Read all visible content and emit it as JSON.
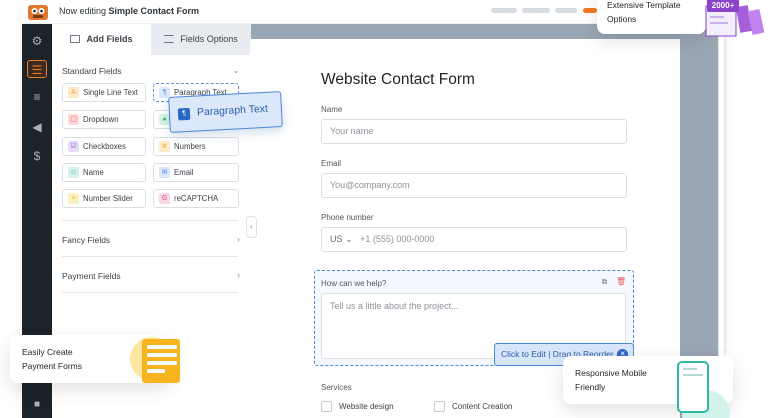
{
  "app": {
    "title_prefix": "Now editing",
    "form_name": "Simple Contact Form"
  },
  "panel": {
    "tabs": [
      {
        "label": "Add Fields"
      },
      {
        "label": "Fields Options"
      }
    ],
    "standard_section": "Standard Fields",
    "fields": [
      {
        "label": "Single Line Text",
        "icon": "text-icon",
        "color": "#f2a541"
      },
      {
        "label": "Paragraph Text",
        "icon": "paragraph-icon",
        "color": "#5e93d6"
      },
      {
        "label": "Dropdown",
        "icon": "dropdown-icon",
        "color": "#e45c5c"
      },
      {
        "label": "",
        "icon": "radio-icon",
        "color": "#3fb36b"
      },
      {
        "label": "Checkboxes",
        "icon": "checkbox-icon",
        "color": "#9a6ad6"
      },
      {
        "label": "Numbers",
        "icon": "hash-icon",
        "color": "#e8a626"
      },
      {
        "label": "Name",
        "icon": "user-icon",
        "color": "#2fb7a5"
      },
      {
        "label": "Email",
        "icon": "mail-icon",
        "color": "#4a88d8"
      },
      {
        "label": "Number Slider",
        "icon": "slider-icon",
        "color": "#e8b826"
      },
      {
        "label": "reCAPTCHA",
        "icon": "google-icon",
        "color": "#d94c8a"
      }
    ],
    "fancy_section": "Fancy Fields",
    "payment_section": "Payment Fields"
  },
  "drag": {
    "label": "Paragraph Text"
  },
  "form": {
    "title": "Website Contact Form",
    "name_label": "Name",
    "name_placeholder": "Your name",
    "email_label": "Email",
    "email_placeholder": "You@company.com",
    "phone_label": "Phone number",
    "phone_country": "US",
    "phone_placeholder": "+1 (555) 000-0000",
    "help_label": "How can we help?",
    "help_placeholder": "Tell us a little about the project...",
    "reorder_hint": "Click to Edit | Drag to Reorder",
    "services_label": "Services",
    "services": [
      "Website design",
      "Content Creation"
    ]
  },
  "promos": {
    "payment_line1": "Easily Create",
    "payment_line2": "Payment Forms",
    "template_line1": "Extensive Template",
    "template_line2": "Options",
    "template_badge": "2000+",
    "mobile_line1": "Responsive Mobile",
    "mobile_line2": "Friendly"
  },
  "colors": {
    "accent": "#f27b20",
    "primary_blue": "#4a88d8",
    "sidebar_bg": "#1d2429",
    "canvas_bg": "#9ba6b4",
    "badge_purple": "#8a43c9"
  }
}
